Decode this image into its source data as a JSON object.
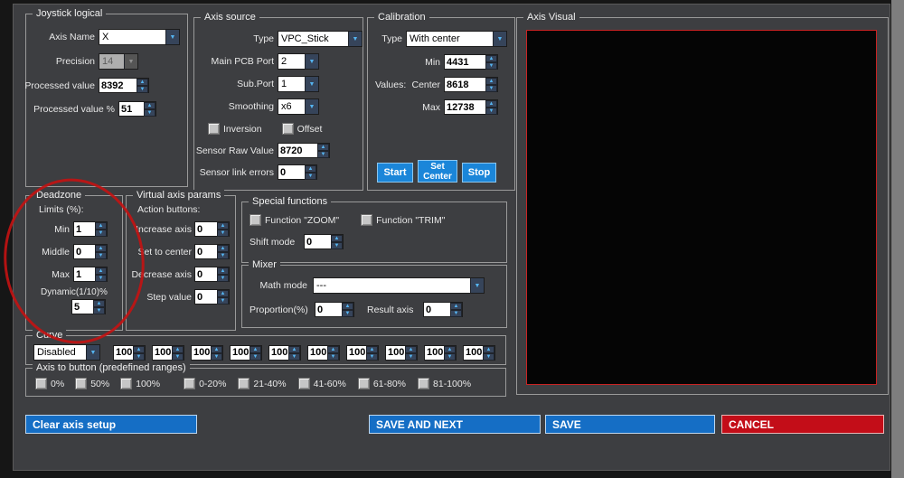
{
  "joystick_logical": {
    "title": "Joystick logical",
    "axis_name_label": "Axis Name",
    "axis_name_value": "X",
    "precision_label": "Precision",
    "precision_value": "14",
    "processed_value_label": "Processed value",
    "processed_value": "8392",
    "processed_pct_label": "Processed value %",
    "processed_pct": "51"
  },
  "axis_source": {
    "title": "Axis source",
    "type_label": "Type",
    "type_value": "VPC_Stick",
    "main_pcb_port_label": "Main PCB Port",
    "main_pcb_port_value": "2",
    "sub_port_label": "Sub.Port",
    "sub_port_value": "1",
    "smoothing_label": "Smoothing",
    "smoothing_value": "x6",
    "inversion_label": "Inversion",
    "offset_label": "Offset",
    "sensor_raw_label": "Sensor Raw Value",
    "sensor_raw_value": "8720",
    "sensor_link_label": "Sensor link errors",
    "sensor_link_value": "0"
  },
  "calibration": {
    "title": "Calibration",
    "type_label": "Type",
    "type_value": "With center",
    "min_label": "Min",
    "min_value": "4431",
    "values_label": "Values:",
    "center_label": "Center",
    "center_value": "8618",
    "max_label": "Max",
    "max_value": "12738",
    "start_button": "Start",
    "set_center_button": "Set Center",
    "stop_button": "Stop"
  },
  "axis_visual": {
    "title": "Axis Visual"
  },
  "deadzone": {
    "title": "Deadzone",
    "limits_label": "Limits (%):",
    "min_label": "Min",
    "min_value": "1",
    "middle_label": "Middle",
    "middle_value": "0",
    "max_label": "Max",
    "max_value": "1",
    "dynamic_label": "Dynamic(1/10)%",
    "dynamic_value": "5"
  },
  "virtual_axis": {
    "title": "Virtual axis params",
    "action_buttons_label": "Action buttons:",
    "increase_label": "Increase axis",
    "increase_value": "0",
    "set_center_label": "Set to center",
    "set_center_value": "0",
    "decrease_label": "Decrease axis",
    "decrease_value": "0",
    "step_label": "Step value",
    "step_value": "0"
  },
  "special_functions": {
    "title": "Special functions",
    "zoom_label": "Function \"ZOOM\"",
    "trim_label": "Function \"TRIM\"",
    "shift_label": "Shift mode",
    "shift_value": "0"
  },
  "mixer": {
    "title": "Mixer",
    "math_mode_label": "Math mode",
    "math_mode_value": "---",
    "proportion_label": "Proportion(%)",
    "proportion_value": "0",
    "result_axis_label": "Result axis",
    "result_axis_value": "0"
  },
  "curve": {
    "title": "Curve",
    "mode_value": "Disabled",
    "points": [
      "100",
      "100",
      "100",
      "100",
      "100",
      "100",
      "100",
      "100",
      "100",
      "100"
    ]
  },
  "axis_to_button": {
    "title": "Axis to button (predefined ranges)",
    "options": [
      "0%",
      "50%",
      "100%",
      "0-20%",
      "21-40%",
      "41-60%",
      "61-80%",
      "81-100%"
    ]
  },
  "footer": {
    "clear_button": "Clear axis setup",
    "save_next_button": "SAVE AND NEXT",
    "save_button": "SAVE",
    "cancel_button": "CANCEL"
  },
  "colors": {
    "panel": "#3d3e41",
    "accent_blue": "#156ec5",
    "small_button_blue": "#1b86d9",
    "cancel_red": "#c30d18",
    "annotation_red": "#c41212",
    "visual_border_red": "#c92323"
  }
}
